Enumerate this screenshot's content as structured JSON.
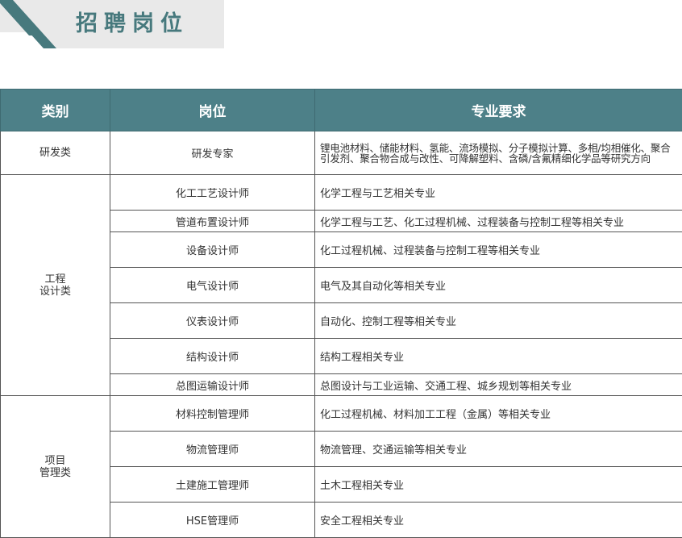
{
  "header": {
    "title": "招聘岗位",
    "accent_color": "#47797d",
    "tab_color": "#e9e9e9"
  },
  "table": {
    "header_bg_color": "#4d8088",
    "columns": [
      "类别",
      "岗位",
      "专业要求"
    ],
    "groups": [
      {
        "category_lines": [
          "研发类"
        ],
        "rows": [
          {
            "position": "研发专家",
            "requirement": "锂电池材料、储能材料、氢能、流场模拟、分子模拟计算、多相/均相催化、聚合引发剂、聚合物合成与改性、可降解塑料、含磷/含氟精细化学品等研究方向"
          }
        ]
      },
      {
        "category_lines": [
          "工程",
          "设计类"
        ],
        "rows": [
          {
            "position": "化工工艺设计师",
            "requirement": "化学工程与工艺相关专业"
          },
          {
            "position": "管道布置设计师",
            "requirement": "化学工程与工艺、化工过程机械、过程装备与控制工程等相关专业"
          },
          {
            "position": "设备设计师",
            "requirement": "化工过程机械、过程装备与控制工程等相关专业"
          },
          {
            "position": "电气设计师",
            "requirement": "电气及其自动化等相关专业"
          },
          {
            "position": "仪表设计师",
            "requirement": "自动化、控制工程等相关专业"
          },
          {
            "position": "结构设计师",
            "requirement": "结构工程相关专业"
          },
          {
            "position": "总图运输设计师",
            "requirement": "总图设计与工业运输、交通工程、城乡规划等相关专业"
          }
        ]
      },
      {
        "category_lines": [
          "项目",
          "管理类"
        ],
        "rows": [
          {
            "position": "材料控制管理师",
            "requirement": "化工过程机械、材料加工工程（金属）等相关专业"
          },
          {
            "position": "物流管理师",
            "requirement": "物流管理、交通运输等相关专业"
          },
          {
            "position": "土建施工管理师",
            "requirement": "土木工程相关专业"
          },
          {
            "position": "HSE管理师",
            "requirement": "安全工程相关专业"
          }
        ]
      }
    ]
  }
}
